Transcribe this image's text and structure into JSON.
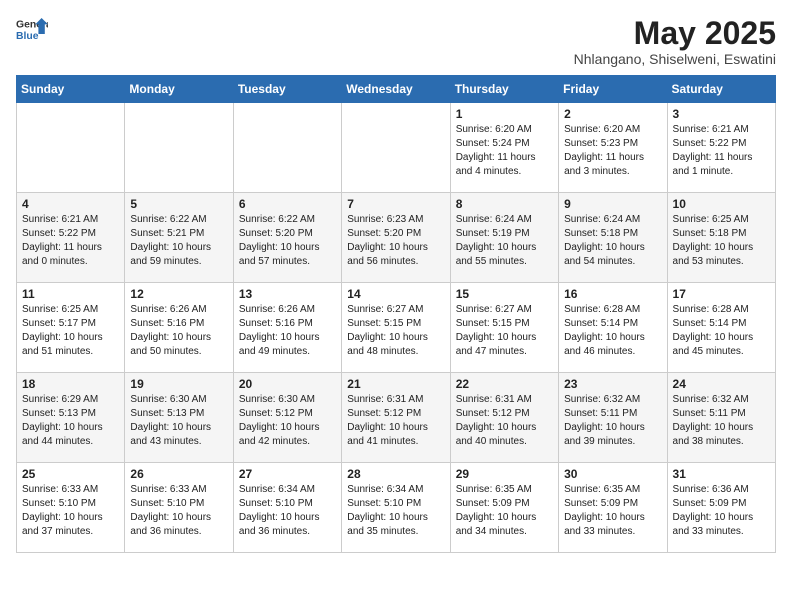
{
  "header": {
    "logo_general": "General",
    "logo_blue": "Blue",
    "month_title": "May 2025",
    "location": "Nhlangano, Shiselweni, Eswatini"
  },
  "weekdays": [
    "Sunday",
    "Monday",
    "Tuesday",
    "Wednesday",
    "Thursday",
    "Friday",
    "Saturday"
  ],
  "weeks": [
    [
      {
        "day": "",
        "sunrise": "",
        "sunset": "",
        "daylight": ""
      },
      {
        "day": "",
        "sunrise": "",
        "sunset": "",
        "daylight": ""
      },
      {
        "day": "",
        "sunrise": "",
        "sunset": "",
        "daylight": ""
      },
      {
        "day": "",
        "sunrise": "",
        "sunset": "",
        "daylight": ""
      },
      {
        "day": "1",
        "sunrise": "Sunrise: 6:20 AM",
        "sunset": "Sunset: 5:24 PM",
        "daylight": "Daylight: 11 hours and 4 minutes."
      },
      {
        "day": "2",
        "sunrise": "Sunrise: 6:20 AM",
        "sunset": "Sunset: 5:23 PM",
        "daylight": "Daylight: 11 hours and 3 minutes."
      },
      {
        "day": "3",
        "sunrise": "Sunrise: 6:21 AM",
        "sunset": "Sunset: 5:22 PM",
        "daylight": "Daylight: 11 hours and 1 minute."
      }
    ],
    [
      {
        "day": "4",
        "sunrise": "Sunrise: 6:21 AM",
        "sunset": "Sunset: 5:22 PM",
        "daylight": "Daylight: 11 hours and 0 minutes."
      },
      {
        "day": "5",
        "sunrise": "Sunrise: 6:22 AM",
        "sunset": "Sunset: 5:21 PM",
        "daylight": "Daylight: 10 hours and 59 minutes."
      },
      {
        "day": "6",
        "sunrise": "Sunrise: 6:22 AM",
        "sunset": "Sunset: 5:20 PM",
        "daylight": "Daylight: 10 hours and 57 minutes."
      },
      {
        "day": "7",
        "sunrise": "Sunrise: 6:23 AM",
        "sunset": "Sunset: 5:20 PM",
        "daylight": "Daylight: 10 hours and 56 minutes."
      },
      {
        "day": "8",
        "sunrise": "Sunrise: 6:24 AM",
        "sunset": "Sunset: 5:19 PM",
        "daylight": "Daylight: 10 hours and 55 minutes."
      },
      {
        "day": "9",
        "sunrise": "Sunrise: 6:24 AM",
        "sunset": "Sunset: 5:18 PM",
        "daylight": "Daylight: 10 hours and 54 minutes."
      },
      {
        "day": "10",
        "sunrise": "Sunrise: 6:25 AM",
        "sunset": "Sunset: 5:18 PM",
        "daylight": "Daylight: 10 hours and 53 minutes."
      }
    ],
    [
      {
        "day": "11",
        "sunrise": "Sunrise: 6:25 AM",
        "sunset": "Sunset: 5:17 PM",
        "daylight": "Daylight: 10 hours and 51 minutes."
      },
      {
        "day": "12",
        "sunrise": "Sunrise: 6:26 AM",
        "sunset": "Sunset: 5:16 PM",
        "daylight": "Daylight: 10 hours and 50 minutes."
      },
      {
        "day": "13",
        "sunrise": "Sunrise: 6:26 AM",
        "sunset": "Sunset: 5:16 PM",
        "daylight": "Daylight: 10 hours and 49 minutes."
      },
      {
        "day": "14",
        "sunrise": "Sunrise: 6:27 AM",
        "sunset": "Sunset: 5:15 PM",
        "daylight": "Daylight: 10 hours and 48 minutes."
      },
      {
        "day": "15",
        "sunrise": "Sunrise: 6:27 AM",
        "sunset": "Sunset: 5:15 PM",
        "daylight": "Daylight: 10 hours and 47 minutes."
      },
      {
        "day": "16",
        "sunrise": "Sunrise: 6:28 AM",
        "sunset": "Sunset: 5:14 PM",
        "daylight": "Daylight: 10 hours and 46 minutes."
      },
      {
        "day": "17",
        "sunrise": "Sunrise: 6:28 AM",
        "sunset": "Sunset: 5:14 PM",
        "daylight": "Daylight: 10 hours and 45 minutes."
      }
    ],
    [
      {
        "day": "18",
        "sunrise": "Sunrise: 6:29 AM",
        "sunset": "Sunset: 5:13 PM",
        "daylight": "Daylight: 10 hours and 44 minutes."
      },
      {
        "day": "19",
        "sunrise": "Sunrise: 6:30 AM",
        "sunset": "Sunset: 5:13 PM",
        "daylight": "Daylight: 10 hours and 43 minutes."
      },
      {
        "day": "20",
        "sunrise": "Sunrise: 6:30 AM",
        "sunset": "Sunset: 5:12 PM",
        "daylight": "Daylight: 10 hours and 42 minutes."
      },
      {
        "day": "21",
        "sunrise": "Sunrise: 6:31 AM",
        "sunset": "Sunset: 5:12 PM",
        "daylight": "Daylight: 10 hours and 41 minutes."
      },
      {
        "day": "22",
        "sunrise": "Sunrise: 6:31 AM",
        "sunset": "Sunset: 5:12 PM",
        "daylight": "Daylight: 10 hours and 40 minutes."
      },
      {
        "day": "23",
        "sunrise": "Sunrise: 6:32 AM",
        "sunset": "Sunset: 5:11 PM",
        "daylight": "Daylight: 10 hours and 39 minutes."
      },
      {
        "day": "24",
        "sunrise": "Sunrise: 6:32 AM",
        "sunset": "Sunset: 5:11 PM",
        "daylight": "Daylight: 10 hours and 38 minutes."
      }
    ],
    [
      {
        "day": "25",
        "sunrise": "Sunrise: 6:33 AM",
        "sunset": "Sunset: 5:10 PM",
        "daylight": "Daylight: 10 hours and 37 minutes."
      },
      {
        "day": "26",
        "sunrise": "Sunrise: 6:33 AM",
        "sunset": "Sunset: 5:10 PM",
        "daylight": "Daylight: 10 hours and 36 minutes."
      },
      {
        "day": "27",
        "sunrise": "Sunrise: 6:34 AM",
        "sunset": "Sunset: 5:10 PM",
        "daylight": "Daylight: 10 hours and 36 minutes."
      },
      {
        "day": "28",
        "sunrise": "Sunrise: 6:34 AM",
        "sunset": "Sunset: 5:10 PM",
        "daylight": "Daylight: 10 hours and 35 minutes."
      },
      {
        "day": "29",
        "sunrise": "Sunrise: 6:35 AM",
        "sunset": "Sunset: 5:09 PM",
        "daylight": "Daylight: 10 hours and 34 minutes."
      },
      {
        "day": "30",
        "sunrise": "Sunrise: 6:35 AM",
        "sunset": "Sunset: 5:09 PM",
        "daylight": "Daylight: 10 hours and 33 minutes."
      },
      {
        "day": "31",
        "sunrise": "Sunrise: 6:36 AM",
        "sunset": "Sunset: 5:09 PM",
        "daylight": "Daylight: 10 hours and 33 minutes."
      }
    ]
  ]
}
